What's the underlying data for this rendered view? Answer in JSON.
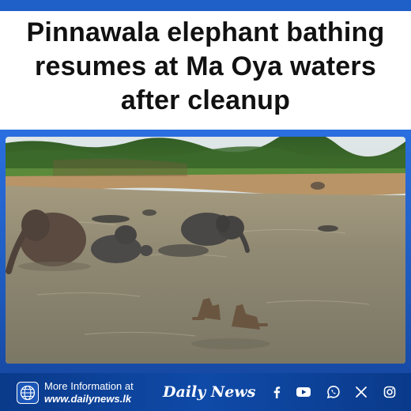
{
  "headline": {
    "line1": "Pinnawala elephant bathing",
    "line2": "resumes at Ma Oya waters",
    "line3": "after cleanup"
  },
  "footer": {
    "more_label": "More Information at",
    "website": "www.dailynews.lk",
    "brand": "Daily News"
  },
  "social_icons": [
    "facebook-icon",
    "youtube-icon",
    "whatsapp-icon",
    "x-icon",
    "instagram-icon"
  ],
  "colors": {
    "brand_blue": "#1f5fc8",
    "footer_blue": "#0b3b86",
    "headline_text": "#111111"
  }
}
